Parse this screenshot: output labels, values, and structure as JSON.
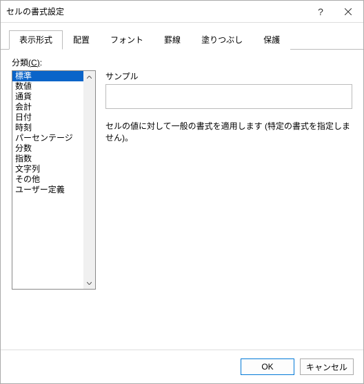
{
  "window": {
    "title": "セルの書式設定"
  },
  "tabs": [
    "表示形式",
    "配置",
    "フォント",
    "罫線",
    "塗りつぶし",
    "保護"
  ],
  "activeTabIndex": 0,
  "category": {
    "label": "分類",
    "accel": "(C)",
    "items": [
      "標準",
      "数値",
      "通貨",
      "会計",
      "日付",
      "時刻",
      "パーセンテージ",
      "分数",
      "指数",
      "文字列",
      "その他",
      "ユーザー定義"
    ],
    "selectedIndex": 0
  },
  "sample": {
    "label": "サンプル",
    "value": ""
  },
  "description": "セルの値に対して一般の書式を適用します (特定の書式を指定しません)。",
  "buttons": {
    "ok": "OK",
    "cancel": "キャンセル"
  }
}
